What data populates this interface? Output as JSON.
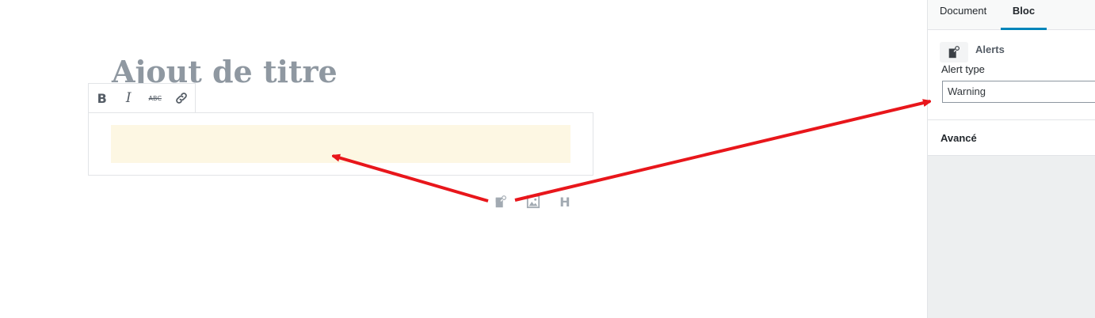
{
  "editor": {
    "title_placeholder": "Ajout de titre",
    "toolbar": {
      "bold_label": "B",
      "italic_label": "I",
      "strike_label": "ABC",
      "link_icon": "link-icon"
    },
    "alert_block_color": "#fdf7e3",
    "inserter": {
      "alert_icon": "alert-block-icon",
      "image_icon": "image-icon",
      "heading_label": "H"
    }
  },
  "sidebar": {
    "tabs": [
      {
        "label": "Document",
        "active": false
      },
      {
        "label": "Bloc",
        "active": true
      }
    ],
    "block": {
      "icon": "alert-block-icon",
      "name": "Alerts",
      "alert_type_label": "Alert type",
      "alert_type_value": "Warning"
    },
    "advanced_label": "Avancé"
  },
  "colors": {
    "accent": "#0085ba",
    "annotation_arrow": "#e8161b",
    "title_placeholder": "#8f98a1"
  }
}
